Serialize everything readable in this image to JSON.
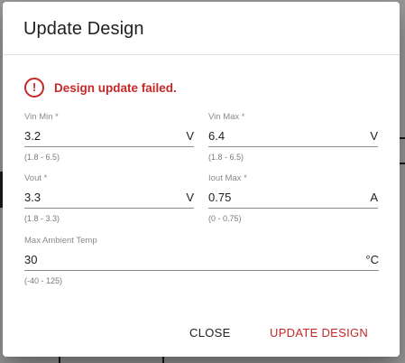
{
  "dialog": {
    "title": "Update Design",
    "error_message": "Design update failed.",
    "error_icon": "exclamation-circle-icon"
  },
  "fields": {
    "vin_min": {
      "label": "Vin Min *",
      "value": "3.2",
      "unit": "V",
      "hint": "(1.8 - 6.5)"
    },
    "vin_max": {
      "label": "Vin Max *",
      "value": "6.4",
      "unit": "V",
      "hint": "(1.8 - 6.5)"
    },
    "vout": {
      "label": "Vout *",
      "value": "3.3",
      "unit": "V",
      "hint": "(1.8 - 3.3)"
    },
    "iout_max": {
      "label": "Iout Max *",
      "value": "0.75",
      "unit": "A",
      "hint": "(0 - 0.75)"
    },
    "max_ambient_temp": {
      "label": "Max Ambient Temp",
      "value": "30",
      "unit": "°C",
      "hint": "(-40 - 125)"
    }
  },
  "actions": {
    "close_label": "CLOSE",
    "update_label": "UPDATE DESIGN"
  },
  "colors": {
    "error": "#c62828",
    "text": "#212121",
    "label": "#8a8a8a"
  }
}
